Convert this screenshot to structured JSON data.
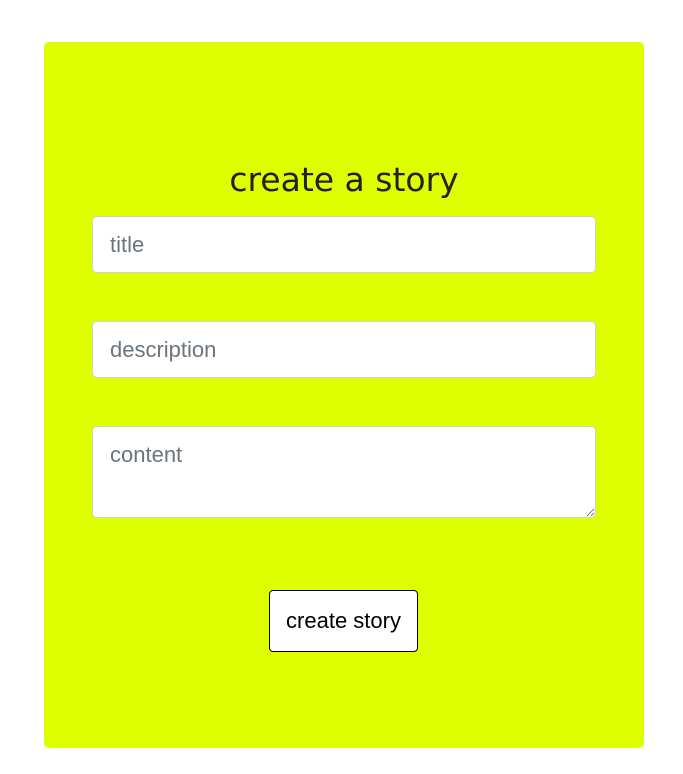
{
  "form": {
    "heading": "create a story",
    "title_placeholder": "title",
    "title_value": "",
    "description_placeholder": "description",
    "description_value": "",
    "content_placeholder": "content",
    "content_value": "",
    "submit_label": "create story"
  },
  "colors": {
    "card_background": "#ddff00",
    "page_background": "#ffffff",
    "placeholder_text": "#6c757d"
  }
}
